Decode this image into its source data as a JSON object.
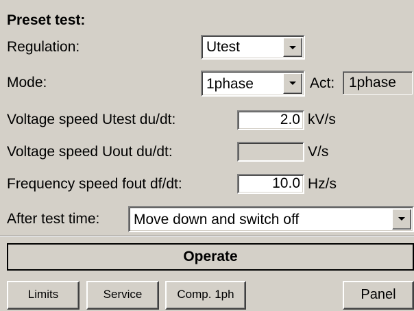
{
  "section": {
    "title": "Preset test:"
  },
  "regulation": {
    "label": "Regulation:",
    "value": "Utest"
  },
  "mode": {
    "label": "Mode:",
    "value": "1phase",
    "act_label": "Act:",
    "act_value": "1phase"
  },
  "voltage_speed_utest": {
    "label": "Voltage speed Utest du/dt:",
    "value": "2.0",
    "unit": "kV/s"
  },
  "voltage_speed_uout": {
    "label": "Voltage speed Uout du/dt:",
    "value": "",
    "unit": "V/s"
  },
  "frequency_speed": {
    "label": "Frequency speed fout df/dt:",
    "value": "10.0",
    "unit": "Hz/s"
  },
  "after_test": {
    "label": "After test time:",
    "value": "Move down and switch off"
  },
  "buttons": {
    "operate": "Operate",
    "limits": "Limits",
    "service": "Service",
    "comp_1ph": "Comp. 1ph",
    "panel": "Panel"
  },
  "icons": {
    "dropdown": "chevron-down-icon"
  }
}
